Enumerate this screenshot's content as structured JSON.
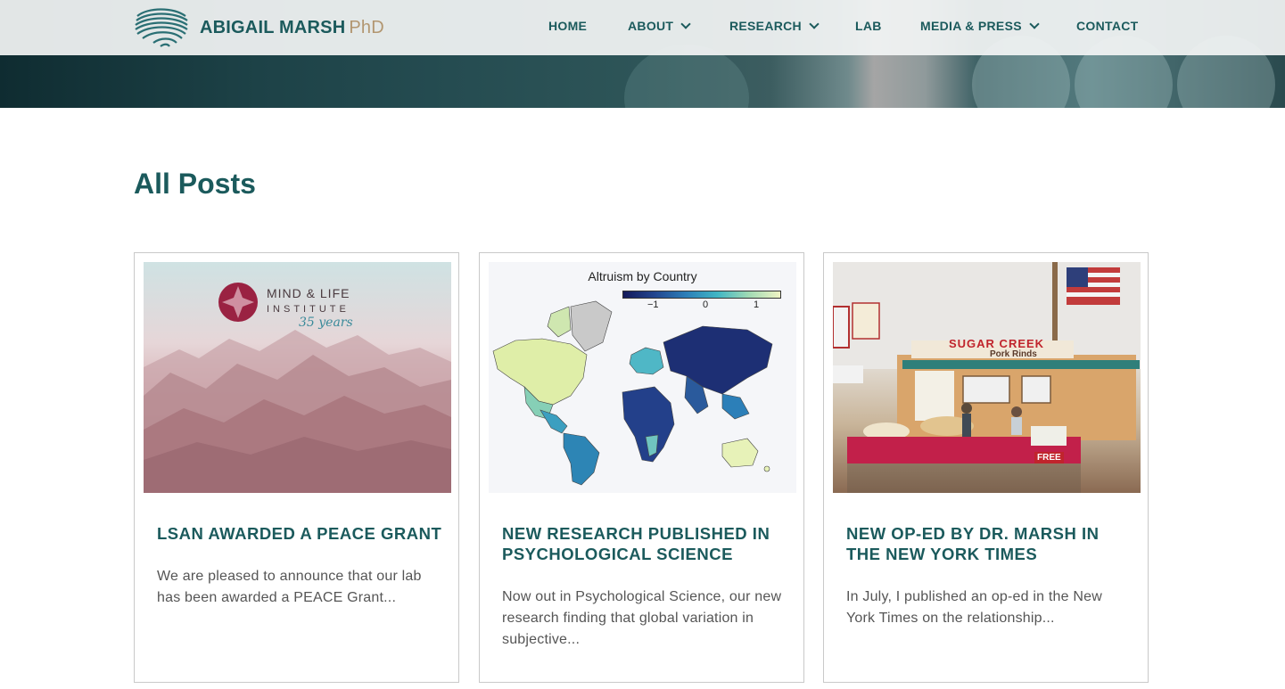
{
  "header": {
    "logo_name": "ABIGAIL MARSH",
    "logo_suffix": "PhD",
    "menu": [
      {
        "label": "HOME",
        "has_dropdown": false
      },
      {
        "label": "ABOUT",
        "has_dropdown": true
      },
      {
        "label": "RESEARCH",
        "has_dropdown": true
      },
      {
        "label": "LAB",
        "has_dropdown": false
      },
      {
        "label": "MEDIA & PRESS",
        "has_dropdown": true
      },
      {
        "label": "CONTACT",
        "has_dropdown": false
      }
    ]
  },
  "page": {
    "title": "All Posts"
  },
  "posts": [
    {
      "title": "LSAN AWARDED A PEACE GRANT",
      "excerpt": "We are pleased to announce that our lab has been awarded a PEACE Grant...",
      "image": {
        "type": "mind-life-mountains",
        "brand_title": "MIND & LIFE",
        "brand_subtitle": "INSTITUTE",
        "brand_years": "35 years"
      }
    },
    {
      "title": "NEW RESEARCH PUBLISHED IN PSYCHOLOGICAL SCIENCE",
      "excerpt": "Now out in Psychological Science, our new research finding that global variation in subjective...",
      "image": {
        "type": "world-map",
        "map_title": "Altruism by Country",
        "ticks": [
          "−1",
          "0",
          "1"
        ]
      }
    },
    {
      "title": "NEW OP-ED BY DR. MARSH IN THE NEW YORK TIMES",
      "excerpt": "In July, I published an op-ed in the New York Times on the relationship...",
      "image": {
        "type": "roadside-stand",
        "sign_text": "SUGAR CREEK",
        "sign_sub": "Pork Rinds",
        "free_text": "FREE"
      }
    }
  ],
  "colors": {
    "brand_teal": "#1b5a5c",
    "brand_gold": "#b29670",
    "text_gray": "#555555",
    "card_border": "#c9c9c9"
  }
}
